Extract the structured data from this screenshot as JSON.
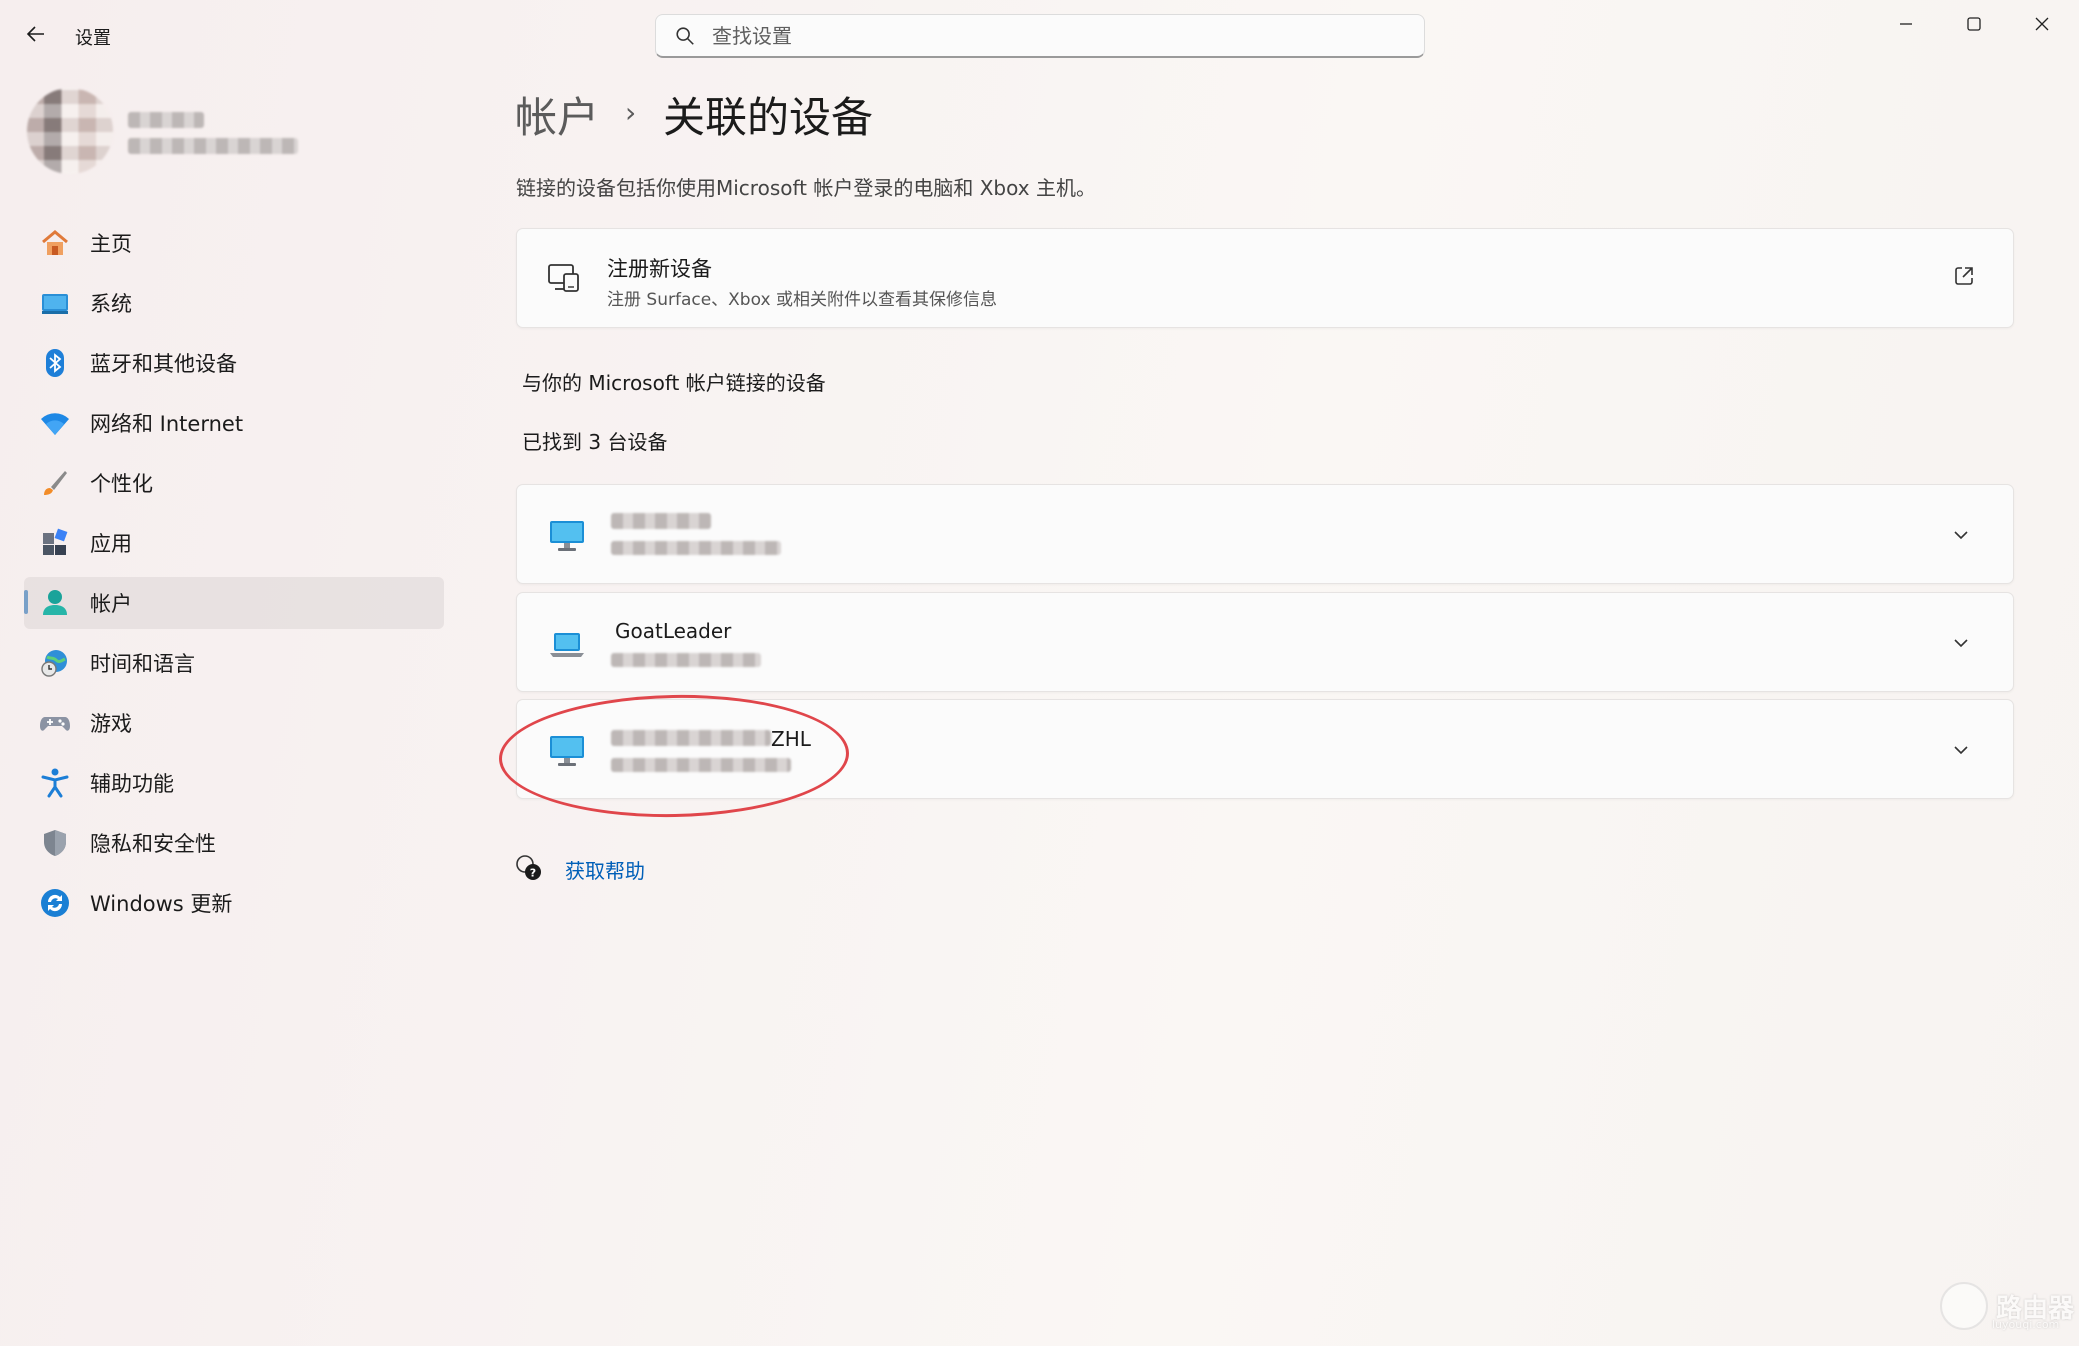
{
  "window": {
    "title": "设置"
  },
  "search": {
    "placeholder": "查找设置"
  },
  "sidebar": {
    "items": [
      {
        "label": "主页",
        "icon": "home-icon"
      },
      {
        "label": "系统",
        "icon": "system-icon"
      },
      {
        "label": "蓝牙和其他设备",
        "icon": "bluetooth-icon"
      },
      {
        "label": "网络和 Internet",
        "icon": "wifi-icon"
      },
      {
        "label": "个性化",
        "icon": "brush-icon"
      },
      {
        "label": "应用",
        "icon": "apps-icon"
      },
      {
        "label": "帐户",
        "icon": "account-icon",
        "selected": true
      },
      {
        "label": "时间和语言",
        "icon": "globe-clock-icon"
      },
      {
        "label": "游戏",
        "icon": "gamepad-icon"
      },
      {
        "label": "辅助功能",
        "icon": "accessibility-icon"
      },
      {
        "label": "隐私和安全性",
        "icon": "shield-icon"
      },
      {
        "label": "Windows 更新",
        "icon": "update-icon"
      }
    ]
  },
  "breadcrumb": {
    "parent": "帐户",
    "separator": "›",
    "current": "关联的设备"
  },
  "description": "链接的设备包括你使用Microsoft 帐户登录的电脑和 Xbox 主机。",
  "register_card": {
    "title": "注册新设备",
    "subtitle": "注册 Surface、Xbox 或相关附件以查看其保修信息"
  },
  "devices_section": {
    "heading": "与你的 Microsoft 帐户链接的设备",
    "count_text": "已找到 3 台设备",
    "devices": [
      {
        "name": "",
        "icon": "desktop-icon"
      },
      {
        "name": "GoatLeader",
        "icon": "laptop-icon"
      },
      {
        "name": "ZHL",
        "icon": "desktop-icon"
      }
    ]
  },
  "help": {
    "label": "获取帮助"
  },
  "watermark": {
    "text": "路由器",
    "sub": "luyouqi.com"
  },
  "colors": {
    "accent": "#005fb8",
    "annotation": "#e0464b"
  }
}
